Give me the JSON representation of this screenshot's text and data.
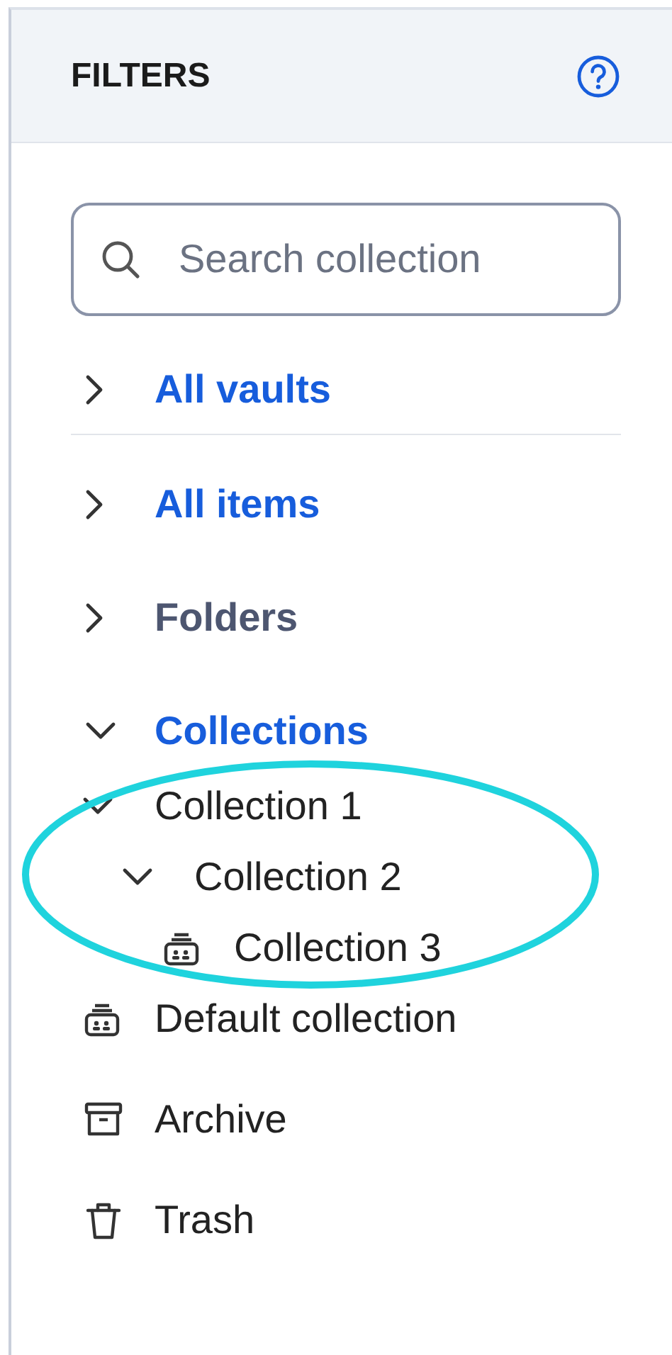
{
  "panel": {
    "title": "FILTERS"
  },
  "search": {
    "placeholder": "Search collection"
  },
  "sections": [
    {
      "label": "All vaults",
      "kind": "link",
      "expanded": false,
      "divider": true
    },
    {
      "label": "All items",
      "kind": "link",
      "expanded": false
    },
    {
      "label": "Folders",
      "kind": "plain",
      "expanded": false
    },
    {
      "label": "Collections",
      "kind": "link",
      "expanded": true,
      "children": [
        {
          "label": "Collection 1",
          "expanded": true,
          "circled": true,
          "children": [
            {
              "label": "Collection 2",
              "expanded": true,
              "children": [
                {
                  "label": "Collection 3"
                }
              ]
            }
          ]
        },
        {
          "label": "Default collection"
        }
      ]
    }
  ],
  "items": [
    {
      "label": "Archive",
      "kind": "archive"
    },
    {
      "label": "Trash",
      "kind": "trash"
    }
  ],
  "annotation": {
    "kind": "ellipse"
  }
}
